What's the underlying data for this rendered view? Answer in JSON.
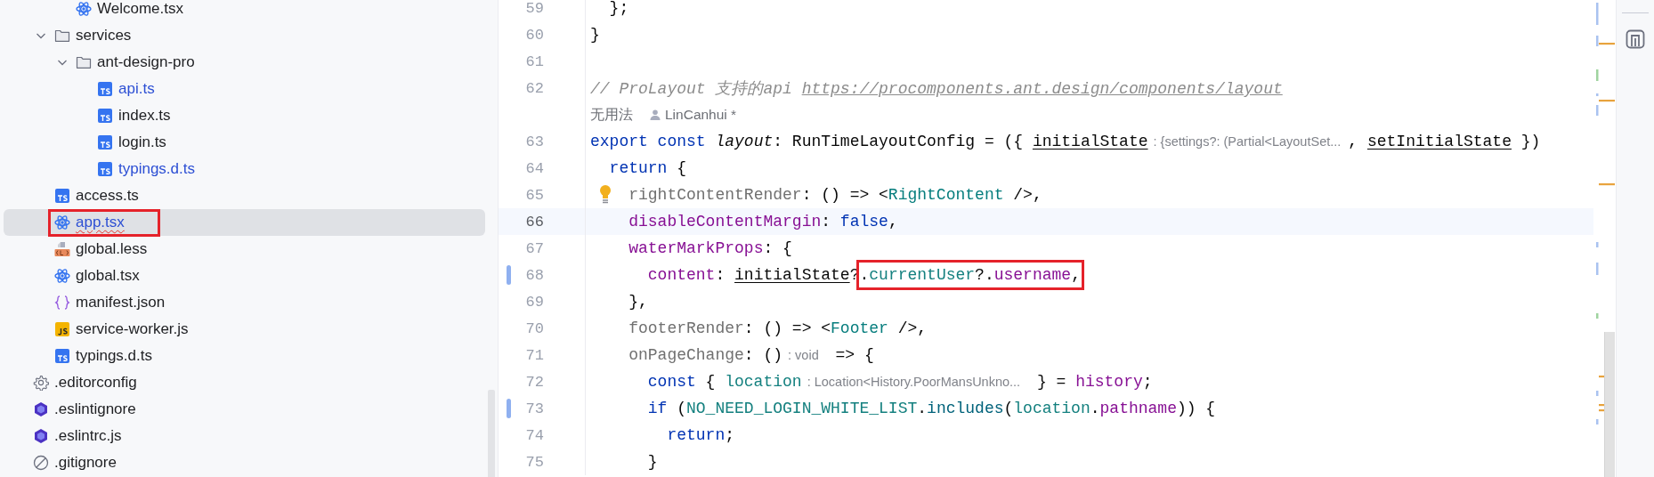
{
  "project_tree": [
    {
      "children": [
        {
          "children": [
            {
              "label": "Welcome.tsx",
              "kind": "react",
              "selected": false,
              "modified": false,
              "error": false,
              "annotated": false
            }
          ]
        },
        {
          "label": "services",
          "kind": "folder",
          "expanded": true,
          "selected": false,
          "modified": false,
          "error": false,
          "annotated": false,
          "children": [
            {
              "label": "ant-design-pro",
              "kind": "folder",
              "expanded": true,
              "selected": false,
              "modified": false,
              "error": false,
              "annotated": false,
              "children": [
                {
                  "label": "api.ts",
                  "kind": "ts",
                  "selected": false,
                  "modified": true,
                  "error": false,
                  "annotated": false
                },
                {
                  "label": "index.ts",
                  "kind": "ts",
                  "selected": false,
                  "modified": false,
                  "error": false,
                  "annotated": false
                },
                {
                  "label": "login.ts",
                  "kind": "ts",
                  "selected": false,
                  "modified": false,
                  "error": false,
                  "annotated": false
                },
                {
                  "label": "typings.d.ts",
                  "kind": "ts",
                  "selected": false,
                  "modified": true,
                  "error": false,
                  "annotated": false
                }
              ]
            }
          ]
        },
        {
          "label": "access.ts",
          "kind": "ts",
          "selected": false,
          "modified": false,
          "error": false,
          "annotated": false
        },
        {
          "label": "app.tsx",
          "kind": "react",
          "selected": true,
          "modified": true,
          "error": true,
          "annotated": true
        },
        {
          "label": "global.less",
          "kind": "less",
          "selected": false,
          "modified": false,
          "error": false,
          "annotated": false
        },
        {
          "label": "global.tsx",
          "kind": "react",
          "selected": false,
          "modified": false,
          "error": false,
          "annotated": false
        },
        {
          "label": "manifest.json",
          "kind": "json",
          "selected": false,
          "modified": false,
          "error": false,
          "annotated": false
        },
        {
          "label": "service-worker.js",
          "kind": "js",
          "selected": false,
          "modified": false,
          "error": false,
          "annotated": false
        },
        {
          "label": "typings.d.ts",
          "kind": "ts",
          "selected": false,
          "modified": false,
          "error": false,
          "annotated": false
        }
      ]
    },
    {
      "label": ".editorconfig",
      "kind": "gear",
      "selected": false,
      "modified": false,
      "error": false,
      "annotated": false
    },
    {
      "label": ".eslintignore",
      "kind": "eslint",
      "selected": false,
      "modified": false,
      "error": false,
      "annotated": false
    },
    {
      "label": ".eslintrc.js",
      "kind": "eslint",
      "selected": false,
      "modified": false,
      "error": false,
      "annotated": false
    },
    {
      "label": ".gitignore",
      "kind": "ignore",
      "selected": false,
      "modified": false,
      "error": false,
      "annotated": false
    }
  ],
  "editor": {
    "lines": [
      {
        "kind": "code",
        "number": "59",
        "current": false,
        "changed": false,
        "bulb": false,
        "segments": [
          {
            "kind": "code",
            "boxed": false,
            "tokens": [
              {
                "kind": "plain",
                "text": "  };"
              }
            ]
          }
        ]
      },
      {
        "kind": "code",
        "number": "60",
        "current": false,
        "changed": false,
        "bulb": false,
        "segments": [
          {
            "kind": "code",
            "boxed": false,
            "tokens": [
              {
                "kind": "plain",
                "text": "}"
              }
            ]
          }
        ]
      },
      {
        "kind": "code",
        "number": "61",
        "current": false,
        "changed": false,
        "bulb": false
      },
      {
        "kind": "code",
        "number": "62",
        "current": false,
        "changed": false,
        "bulb": false,
        "segments": [
          {
            "kind": "code",
            "boxed": false,
            "tokens": [
              {
                "kind": "comment",
                "text": "// ProLayout 支持的api "
              },
              {
                "kind": "link",
                "text": "https://procomponents.ant.design/components/layout"
              }
            ]
          }
        ]
      },
      {
        "kind": "inlay",
        "usages": "无用法",
        "author": "LinCanhui *"
      },
      {
        "kind": "code",
        "number": "63",
        "current": false,
        "changed": false,
        "bulb": false,
        "segments": [
          {
            "kind": "code",
            "boxed": false,
            "tokens": [
              {
                "kind": "keyword",
                "text": "export const "
              },
              {
                "kind": "italic",
                "text": "layout"
              },
              {
                "kind": "plain",
                "text": ": RunTimeLayoutConfig = ({ "
              },
              {
                "kind": "param",
                "text": "initialState"
              }
            ]
          },
          {
            "kind": "hint",
            "text": ": {settings?: (Partial<LayoutSet..."
          },
          {
            "kind": "code",
            "boxed": false,
            "tokens": [
              {
                "kind": "plain",
                "text": ", "
              },
              {
                "kind": "param",
                "text": "setInitialState"
              },
              {
                "kind": "plain",
                "text": " })"
              }
            ]
          }
        ]
      },
      {
        "kind": "code",
        "number": "64",
        "current": false,
        "changed": false,
        "bulb": false,
        "segments": [
          {
            "kind": "code",
            "boxed": false,
            "tokens": [
              {
                "kind": "keyword",
                "text": "  return"
              },
              {
                "kind": "plain",
                "text": " {"
              }
            ]
          }
        ]
      },
      {
        "kind": "code",
        "number": "65",
        "current": false,
        "changed": false,
        "bulb": true,
        "segments": [
          {
            "kind": "code",
            "boxed": false,
            "tokens": [
              {
                "kind": "dim",
                "text": "    rightContentRender"
              },
              {
                "kind": "plain",
                "text": ": () => <"
              },
              {
                "kind": "tag",
                "text": "RightContent"
              },
              {
                "kind": "plain",
                "text": " />,"
              }
            ]
          }
        ]
      },
      {
        "kind": "code",
        "number": "66",
        "current": true,
        "changed": false,
        "bulb": false,
        "segments": [
          {
            "kind": "code",
            "boxed": false,
            "tokens": [
              {
                "kind": "prop",
                "text": "    disableContentMargin"
              },
              {
                "kind": "plain",
                "text": ": "
              },
              {
                "kind": "keyword",
                "text": "false"
              },
              {
                "kind": "plain",
                "text": ","
              }
            ]
          }
        ]
      },
      {
        "kind": "code",
        "number": "67",
        "current": false,
        "changed": false,
        "bulb": false,
        "segments": [
          {
            "kind": "code",
            "boxed": false,
            "tokens": [
              {
                "kind": "prop",
                "text": "    waterMarkProps"
              },
              {
                "kind": "plain",
                "text": ": {"
              }
            ]
          }
        ]
      },
      {
        "kind": "code",
        "number": "68",
        "current": false,
        "changed": true,
        "bulb": false,
        "segments": [
          {
            "kind": "code",
            "boxed": false,
            "tokens": [
              {
                "kind": "prop",
                "text": "      content"
              },
              {
                "kind": "plain",
                "text": ": "
              },
              {
                "kind": "param",
                "text": "initialState"
              },
              {
                "kind": "plain",
                "text": "?"
              }
            ]
          },
          {
            "kind": "code",
            "boxed": true,
            "tokens": [
              {
                "kind": "plain",
                "text": "."
              },
              {
                "kind": "var",
                "text": "currentUser"
              },
              {
                "kind": "plain",
                "text": "?."
              },
              {
                "kind": "prop",
                "text": "username"
              },
              {
                "kind": "plain",
                "text": ","
              }
            ]
          }
        ]
      },
      {
        "kind": "code",
        "number": "69",
        "current": false,
        "changed": false,
        "bulb": false,
        "segments": [
          {
            "kind": "code",
            "boxed": false,
            "tokens": [
              {
                "kind": "plain",
                "text": "    },"
              }
            ]
          }
        ]
      },
      {
        "kind": "code",
        "number": "70",
        "current": false,
        "changed": false,
        "bulb": false,
        "segments": [
          {
            "kind": "code",
            "boxed": false,
            "tokens": [
              {
                "kind": "dim",
                "text": "    footerRender"
              },
              {
                "kind": "plain",
                "text": ": () => <"
              },
              {
                "kind": "tag",
                "text": "Footer"
              },
              {
                "kind": "plain",
                "text": " />,"
              }
            ]
          }
        ]
      },
      {
        "kind": "code",
        "number": "71",
        "current": false,
        "changed": false,
        "bulb": false,
        "segments": [
          {
            "kind": "code",
            "boxed": false,
            "tokens": [
              {
                "kind": "dim",
                "text": "    onPageChange"
              },
              {
                "kind": "plain",
                "text": ": ()"
              }
            ]
          },
          {
            "kind": "hint",
            "text": ": void"
          },
          {
            "kind": "code",
            "boxed": false,
            "tokens": [
              {
                "kind": "plain",
                "text": " => {"
              }
            ]
          }
        ]
      },
      {
        "kind": "code",
        "number": "72",
        "current": false,
        "changed": false,
        "bulb": false,
        "segments": [
          {
            "kind": "code",
            "boxed": false,
            "tokens": [
              {
                "kind": "keyword",
                "text": "      const"
              },
              {
                "kind": "plain",
                "text": " { "
              },
              {
                "kind": "var",
                "text": "location"
              }
            ]
          },
          {
            "kind": "hint",
            "text": ": Location<History.PoorMansUnkno..."
          },
          {
            "kind": "code",
            "boxed": false,
            "tokens": [
              {
                "kind": "plain",
                "text": " } = "
              },
              {
                "kind": "prop",
                "text": "history"
              },
              {
                "kind": "plain",
                "text": ";"
              }
            ]
          }
        ]
      },
      {
        "kind": "code",
        "number": "73",
        "current": false,
        "changed": true,
        "bulb": false,
        "segments": [
          {
            "kind": "code",
            "boxed": false,
            "tokens": [
              {
                "kind": "keyword",
                "text": "      if"
              },
              {
                "kind": "plain",
                "text": " ("
              },
              {
                "kind": "var",
                "text": "NO_NEED_LOGIN_WHITE_LIST"
              },
              {
                "kind": "plain",
                "text": "."
              },
              {
                "kind": "call",
                "text": "includes"
              },
              {
                "kind": "plain",
                "text": "("
              },
              {
                "kind": "var",
                "text": "location"
              },
              {
                "kind": "plain",
                "text": "."
              },
              {
                "kind": "prop",
                "text": "pathname"
              },
              {
                "kind": "plain",
                "text": ")) {"
              }
            ]
          }
        ]
      },
      {
        "kind": "code",
        "number": "74",
        "current": false,
        "changed": false,
        "bulb": false,
        "segments": [
          {
            "kind": "code",
            "boxed": false,
            "tokens": [
              {
                "kind": "keyword",
                "text": "        return"
              },
              {
                "kind": "plain",
                "text": ";"
              }
            ]
          }
        ]
      },
      {
        "kind": "code",
        "number": "75",
        "current": false,
        "changed": false,
        "bulb": false,
        "segments": [
          {
            "kind": "code",
            "boxed": false,
            "tokens": [
              {
                "kind": "plain",
                "text": "      }"
              }
            ]
          }
        ]
      }
    ]
  }
}
